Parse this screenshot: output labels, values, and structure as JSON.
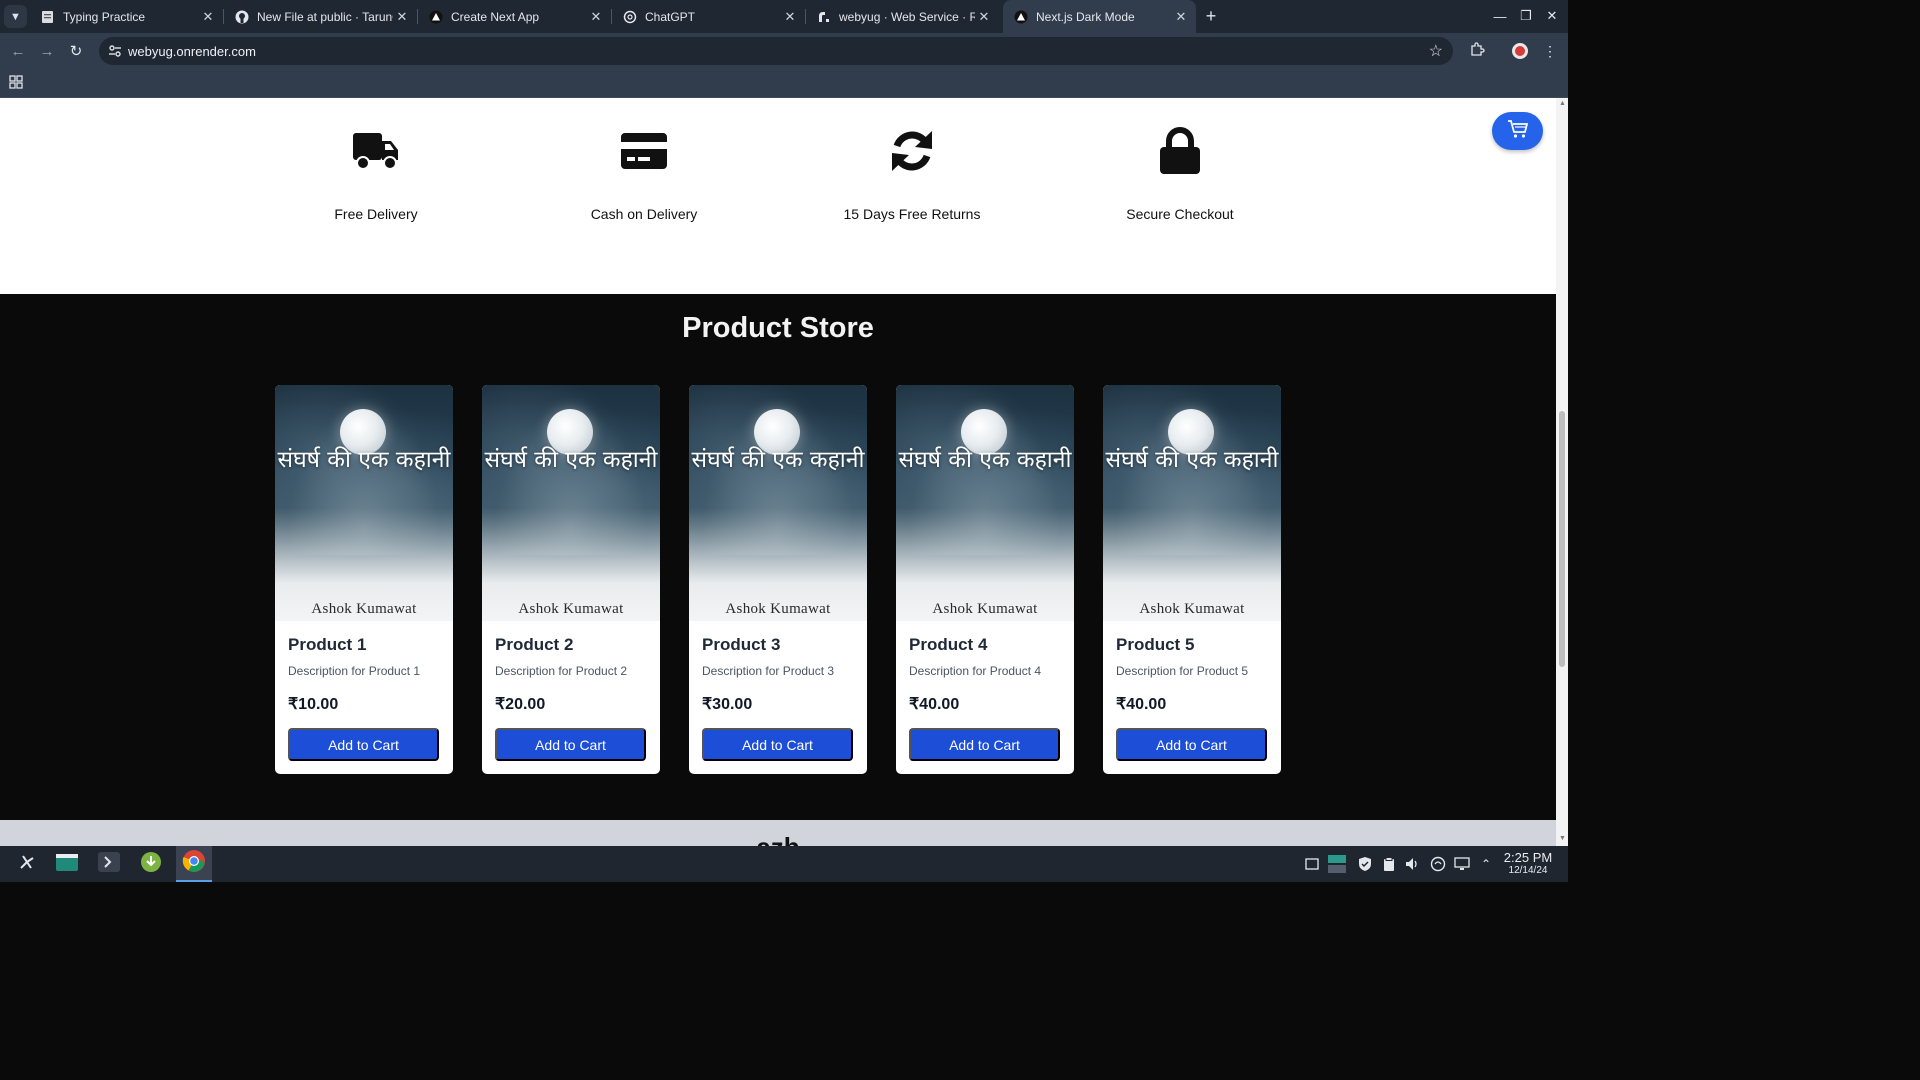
{
  "browser": {
    "tabs": [
      {
        "title": "Typing Practice",
        "icon": "document-icon"
      },
      {
        "title": "New File at public · TarunGu",
        "icon": "github-icon"
      },
      {
        "title": "Create Next App",
        "icon": "triangle-icon"
      },
      {
        "title": "ChatGPT",
        "icon": "openai-icon"
      },
      {
        "title": "webyug · Web Service · R",
        "icon": "render-icon"
      },
      {
        "title": "Next.js Dark Mode",
        "icon": "triangle-icon"
      }
    ],
    "active_tab": 5,
    "url": "webyug.onrender.com"
  },
  "features": [
    {
      "label": "Free Delivery",
      "icon": "truck-icon"
    },
    {
      "label": "Cash on Delivery",
      "icon": "credit-card-icon"
    },
    {
      "label": "15 Days Free Returns",
      "icon": "refresh-icon"
    },
    {
      "label": "Secure Checkout",
      "icon": "lock-icon"
    }
  ],
  "store": {
    "title": "Product Store",
    "products": [
      {
        "name": "Product 1",
        "description": "Description for Product 1",
        "price": "₹10.00",
        "button": "Add to Cart",
        "cover_title": "संघर्ष की एक कहानी",
        "cover_author": "Ashok Kumawat"
      },
      {
        "name": "Product 2",
        "description": "Description for Product 2",
        "price": "₹20.00",
        "button": "Add to Cart",
        "cover_title": "संघर्ष की एक कहानी",
        "cover_author": "Ashok Kumawat"
      },
      {
        "name": "Product 3",
        "description": "Description for Product 3",
        "price": "₹30.00",
        "button": "Add to Cart",
        "cover_title": "संघर्ष की एक कहानी",
        "cover_author": "Ashok Kumawat"
      },
      {
        "name": "Product 4",
        "description": "Description for Product 4",
        "price": "₹40.00",
        "button": "Add to Cart",
        "cover_title": "संघर्ष की एक कहानी",
        "cover_author": "Ashok Kumawat"
      },
      {
        "name": "Product 5",
        "description": "Description for Product 5",
        "price": "₹40.00",
        "button": "Add to Cart",
        "cover_title": "संघर्ष की एक कहानी",
        "cover_author": "Ashok Kumawat"
      }
    ]
  },
  "footer": {
    "logo": "azb"
  },
  "taskbar": {
    "time": "2:25 PM",
    "date": "12/14/24"
  },
  "colors": {
    "accent": "#2563eb",
    "button": "#1d4ed8",
    "store_bg": "#0a0a0a",
    "chrome_bg": "#313c4c"
  }
}
